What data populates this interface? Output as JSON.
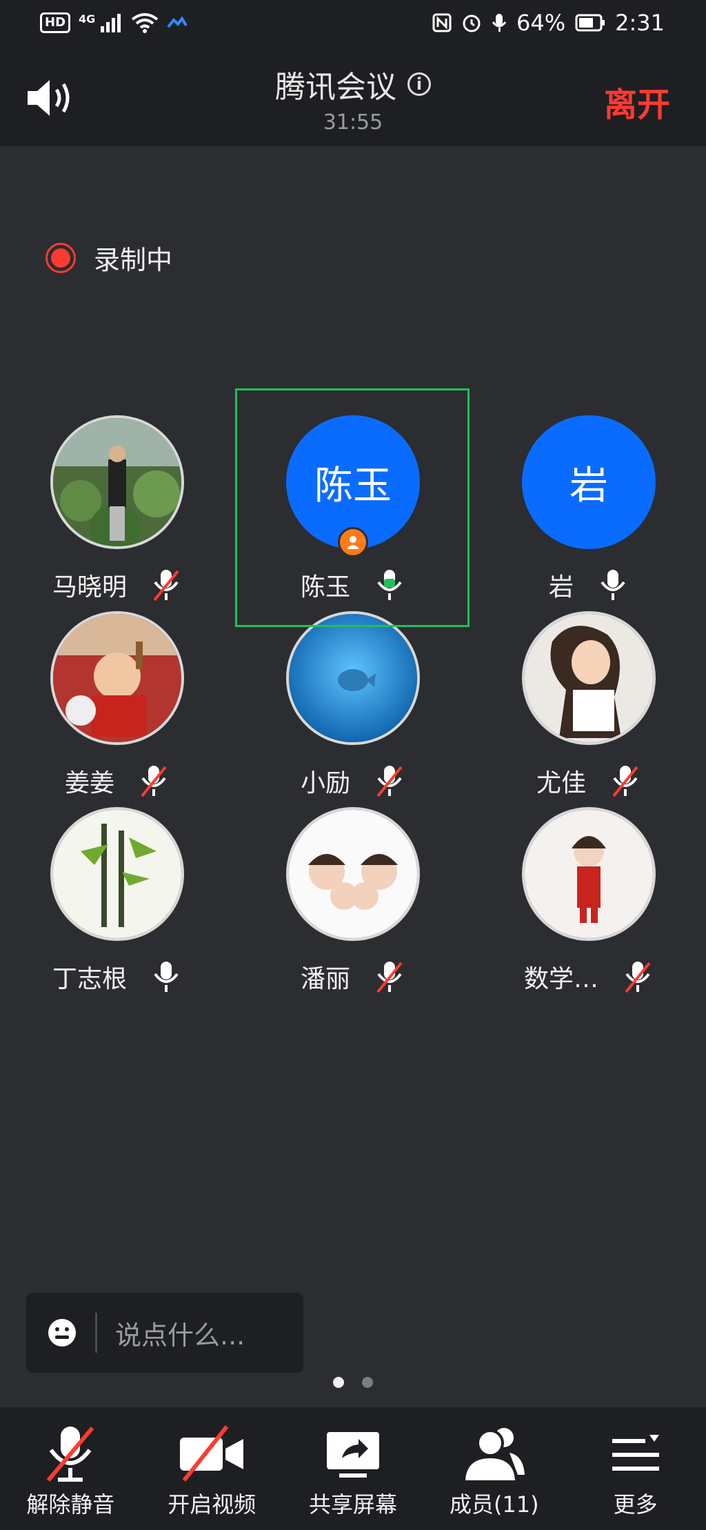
{
  "status_bar": {
    "left_badge": "HD",
    "network": "4G",
    "battery": "64%",
    "time": "2:31"
  },
  "header": {
    "title": "腾讯会议",
    "timer": "31:55",
    "leave_label": "离开"
  },
  "recording": {
    "label": "录制中"
  },
  "participants": [
    {
      "name": "马晓明",
      "avatar": "photo",
      "mic": "muted"
    },
    {
      "name": "陈玉",
      "avatar": "initials",
      "initials": "陈玉",
      "mic": "speaking",
      "host": true
    },
    {
      "name": "岩",
      "avatar": "initials",
      "initials": "岩",
      "mic": "on"
    },
    {
      "name": "姜姜",
      "avatar": "photo",
      "mic": "muted"
    },
    {
      "name": "小励",
      "avatar": "photo",
      "mic": "muted"
    },
    {
      "name": "尤佳",
      "avatar": "photo",
      "mic": "muted"
    },
    {
      "name": "丁志根",
      "avatar": "photo",
      "mic": "on"
    },
    {
      "name": "潘丽",
      "avatar": "photo",
      "mic": "muted"
    },
    {
      "name": "数学…",
      "avatar": "photo",
      "mic": "muted"
    }
  ],
  "chat": {
    "placeholder": "说点什么..."
  },
  "toolbar": {
    "unmute": "解除静音",
    "video": "开启视频",
    "share": "共享屏幕",
    "members": "成员(11)",
    "more": "更多"
  },
  "colors": {
    "accent_blue": "#0a6cff",
    "leave_red": "#ff3b30",
    "speaking_green": "#1fc05a",
    "host_orange": "#ff7a1a"
  }
}
